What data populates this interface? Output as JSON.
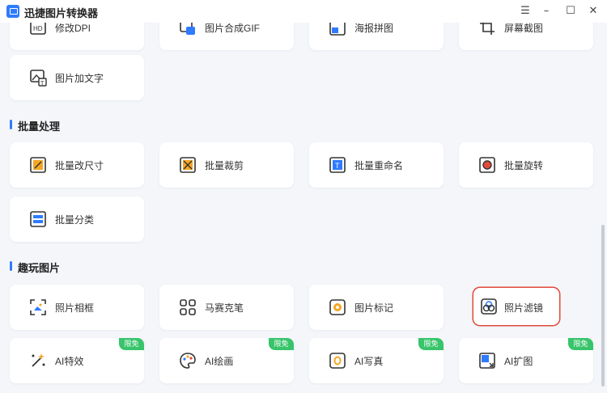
{
  "app": {
    "title": "迅捷图片转换器"
  },
  "window": {
    "minimize": "–",
    "restore": "❐",
    "maximize": "☐",
    "close": "✕"
  },
  "top_cards": [
    {
      "label": "修改DPI",
      "icon": "hd-icon"
    },
    {
      "label": "图片合成GIF",
      "icon": "gif-compose-icon"
    },
    {
      "label": "海报拼图",
      "icon": "collage-icon"
    },
    {
      "label": "屏幕截图",
      "icon": "screenshot-icon"
    },
    {
      "label": "图片加文字",
      "icon": "add-text-icon"
    }
  ],
  "sections": [
    {
      "title": "批量处理"
    },
    {
      "title": "趣玩图片"
    }
  ],
  "batch": [
    {
      "label": "批量改尺寸",
      "icon": "resize-icon"
    },
    {
      "label": "批量裁剪",
      "icon": "crop-icon"
    },
    {
      "label": "批量重命名",
      "icon": "rename-icon"
    },
    {
      "label": "批量旋转",
      "icon": "rotate-icon"
    },
    {
      "label": "批量分类",
      "icon": "classify-icon"
    }
  ],
  "fun": [
    {
      "label": "照片相框",
      "icon": "frame-icon"
    },
    {
      "label": "马赛克笔",
      "icon": "mosaic-icon"
    },
    {
      "label": "图片标记",
      "icon": "mark-icon"
    },
    {
      "label": "照片滤镜",
      "icon": "filter-icon",
      "selected": true
    },
    {
      "label": "AI特效",
      "icon": "ai-effect-icon",
      "badge": "限免"
    },
    {
      "label": "AI绘画",
      "icon": "palette-icon",
      "badge": "限免"
    },
    {
      "label": "AI写真",
      "icon": "portrait-icon",
      "badge": "限免"
    },
    {
      "label": "AI扩图",
      "icon": "expand-icon",
      "badge": "限免"
    }
  ],
  "colors": {
    "accent": "#2f7bff",
    "badge": "#38c46b",
    "selected_border": "#e24a3b",
    "background": "#f4f6fa"
  }
}
